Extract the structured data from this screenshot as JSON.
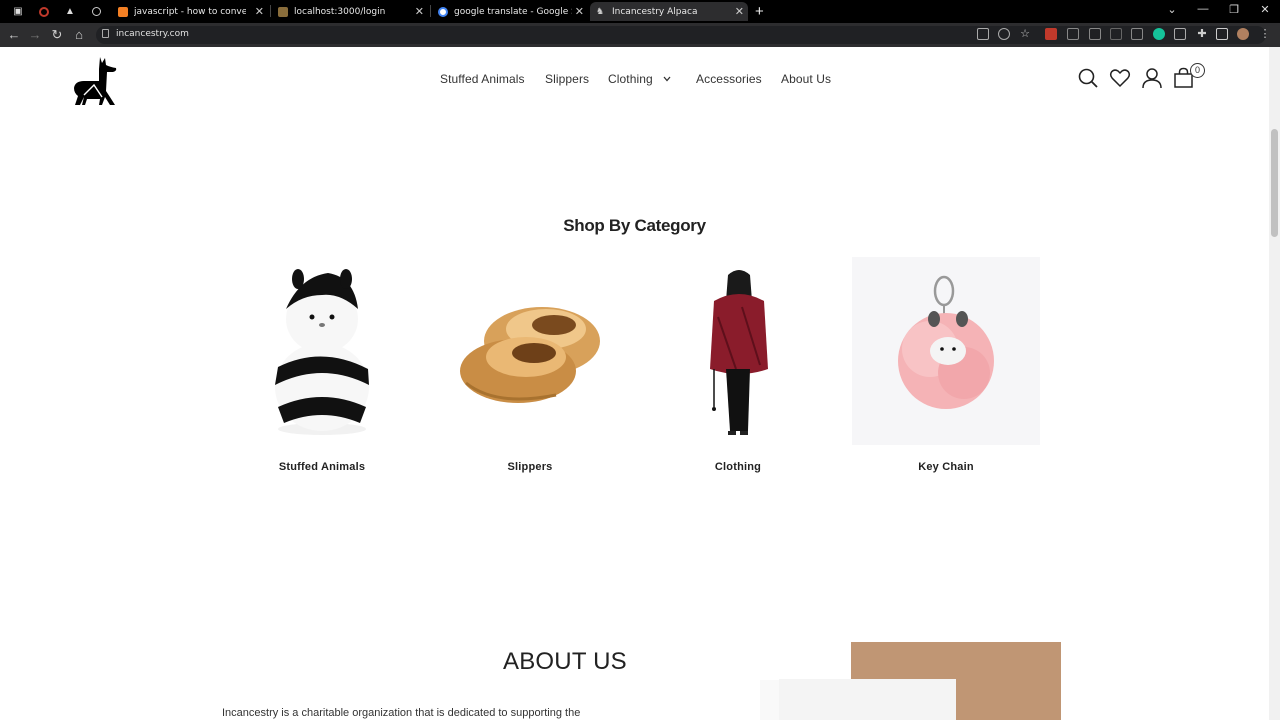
{
  "browser": {
    "tabs": [
      {
        "title": "javascript - how to convert a file",
        "favicon_color": "#f48024"
      },
      {
        "title": "localhost:3000/login",
        "favicon_color": "#8a6d3b"
      },
      {
        "title": "google translate - Google Search",
        "favicon_color": "#4285f4"
      },
      {
        "title": "Incancestry Alpaca",
        "favicon_color": "#222222",
        "active": true
      }
    ],
    "new_tab_label": "+",
    "url": "incancestry.com"
  },
  "header": {
    "logo_alt": "llama-logo",
    "nav": [
      {
        "label": "Stuffed Animals"
      },
      {
        "label": "Slippers"
      },
      {
        "label": "Clothing"
      },
      {
        "label": "Accessories"
      },
      {
        "label": "About Us"
      }
    ],
    "cart_count": "0"
  },
  "categories": {
    "title": "Shop By Category",
    "items": [
      {
        "label": "Stuffed Animals"
      },
      {
        "label": "Slippers"
      },
      {
        "label": "Clothing"
      },
      {
        "label": "Key Chain"
      }
    ]
  },
  "about": {
    "title": "ABOUT US",
    "text": "Incancestry is a charitable organization that is dedicated to supporting the",
    "accent_color": "#c09674"
  }
}
